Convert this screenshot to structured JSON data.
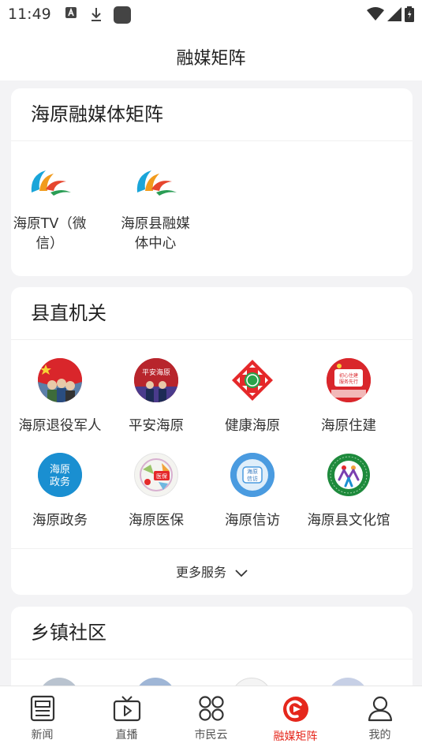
{
  "status_bar": {
    "time": "11:49"
  },
  "app_bar": {
    "title": "融媒矩阵"
  },
  "sections": {
    "matrix": {
      "title": "海原融媒体矩阵",
      "items": [
        {
          "label": "海原TV（微信）",
          "icon": "haiyuan-media-logo"
        },
        {
          "label": "海原县融媒体中心",
          "icon": "haiyuan-media-logo"
        }
      ]
    },
    "county": {
      "title": "县直机关",
      "items": [
        {
          "label": "海原退役军人",
          "icon": "veterans-flag-avatar"
        },
        {
          "label": "平安海原",
          "icon": "safe-haiyuan-avatar",
          "icon_text": "平安海原"
        },
        {
          "label": "健康海原",
          "icon": "health-cross-avatar"
        },
        {
          "label": "海原住建",
          "icon": "housing-avatar",
          "icon_text": "初心住建 服务先行"
        },
        {
          "label": "海原政务",
          "icon": "government-avatar",
          "icon_text": "海原政务"
        },
        {
          "label": "海原医保",
          "icon": "medical-insurance-avatar",
          "icon_text": "医保"
        },
        {
          "label": "海原信访",
          "icon": "petition-avatar",
          "icon_text": "海原信访"
        },
        {
          "label": "海原县文化馆",
          "icon": "culture-center-avatar"
        }
      ],
      "more_label": "更多服务"
    },
    "towns": {
      "title": "乡镇社区"
    }
  },
  "tabs": [
    {
      "label": "新闻",
      "icon": "news-icon",
      "active": false
    },
    {
      "label": "直播",
      "icon": "tv-icon",
      "active": false
    },
    {
      "label": "市民云",
      "icon": "apps-icon",
      "active": false
    },
    {
      "label": "融媒矩阵",
      "icon": "matrix-icon",
      "active": true
    },
    {
      "label": "我的",
      "icon": "profile-icon",
      "active": false
    }
  ],
  "colors": {
    "accent": "#e5271c",
    "background": "#f3f3f5",
    "card": "#ffffff"
  }
}
